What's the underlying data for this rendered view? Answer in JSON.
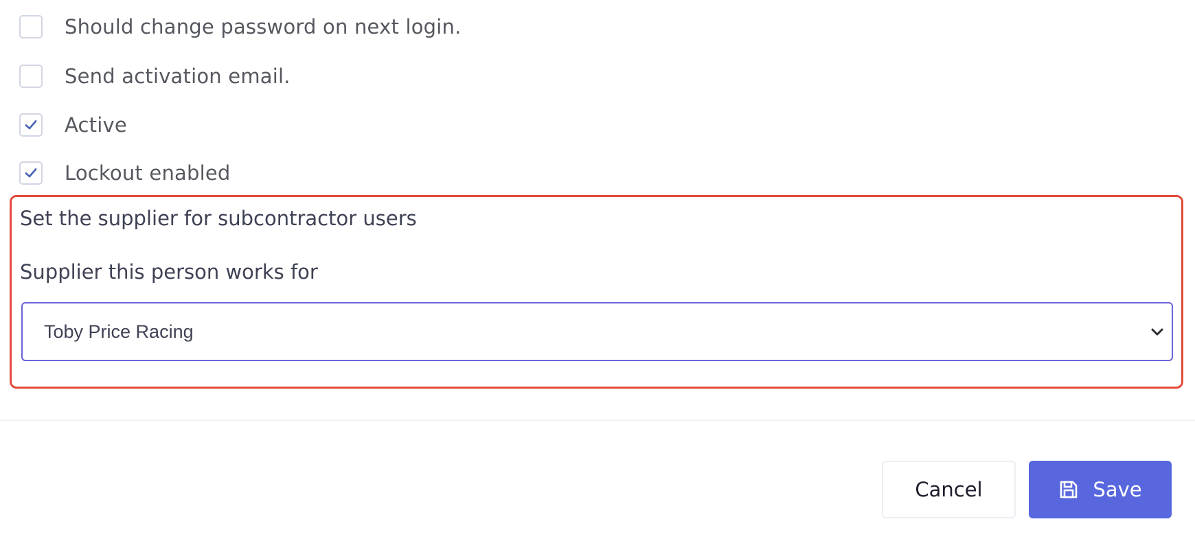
{
  "options": {
    "change_password": {
      "label": "Should change password on next login.",
      "checked": false
    },
    "send_activation": {
      "label": "Send activation email.",
      "checked": false
    },
    "active": {
      "label": "Active",
      "checked": true
    },
    "lockout": {
      "label": "Lockout enabled",
      "checked": true
    }
  },
  "supplier": {
    "heading": "Set the supplier for subcontractor users",
    "field_label": "Supplier this person works for",
    "selected": "Toby Price Racing"
  },
  "footer": {
    "cancel_label": "Cancel",
    "save_label": "Save"
  },
  "icons": {
    "check": "check-icon",
    "chevron": "chevron-down-icon",
    "save": "floppy-disk-icon"
  },
  "colors": {
    "accent": "#5867dd",
    "highlight_border": "#e34a3a",
    "select_border": "#6c63d8",
    "checkmark": "#4c67b6"
  }
}
